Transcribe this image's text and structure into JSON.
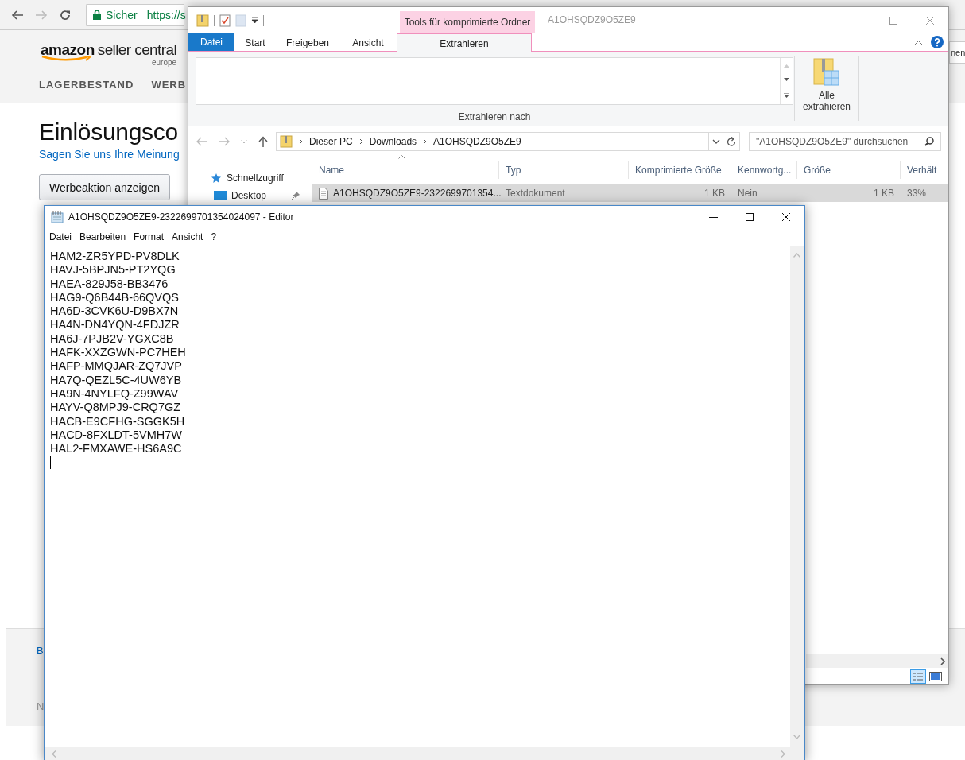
{
  "browser": {
    "security": "Sicher",
    "url": "https://s",
    "logo_brand": "amazon",
    "logo_product": "seller central",
    "logo_region": "europe",
    "nav": [
      "LAGERBESTAND",
      "WERB"
    ],
    "right_fragment": "nen",
    "heading": "Einlösungsco",
    "feedback_link": "Sagen Sie uns Ihre Meinung",
    "show_button": "Werbeaktion anzeigen",
    "footer": [
      "B",
      "N"
    ]
  },
  "explorer": {
    "contextual_group": "Tools für komprimierte Ordner",
    "title": "A1OHSQDZ9O5ZE9",
    "file_tab": "Datei",
    "tabs": [
      {
        "label": "Start",
        "selected": false
      },
      {
        "label": "Freigeben",
        "selected": false
      },
      {
        "label": "Ansicht",
        "selected": false
      },
      {
        "label": "Extrahieren",
        "selected": true
      }
    ],
    "ribbon_group": "Extrahieren nach",
    "extract_all": "Alle extrahieren",
    "breadcrumb": [
      "Dieser PC",
      "Downloads",
      "A1OHSQDZ9O5ZE9"
    ],
    "search": {
      "placeholder": "\"A1OHSQDZ9O5ZE9\" durchsuchen"
    },
    "nav": [
      {
        "label": "Schnellzugriff",
        "kind": "quick-access"
      },
      {
        "label": "Desktop",
        "kind": "desktop"
      }
    ],
    "columns": [
      "Name",
      "Typ",
      "Komprimierte Größe",
      "Kennwortg...",
      "Größe",
      "Verhält"
    ],
    "files": [
      {
        "cells": [
          "A1OHSQDZ9O5ZE9-2322699701354...",
          "Textdokument",
          "1 KB",
          "Nein",
          "1 KB",
          "33%"
        ],
        "selected": true
      }
    ]
  },
  "notepad": {
    "title": "A1OHSQDZ9O5ZE9-2322699701354024097 - Editor",
    "menu": [
      "Datei",
      "Bearbeiten",
      "Format",
      "Ansicht",
      "?"
    ],
    "lines": [
      "HAM2-ZR5YPD-PV8DLK",
      "HAVJ-5BPJN5-PT2YQG",
      "HAEA-829J58-BB3476",
      "HAG9-Q6B44B-66QVQS",
      "HA6D-3CVK6U-D9BX7N",
      "HA4N-DN4YQN-4FDJZR",
      "HA6J-7PJB2V-YGXC8B",
      "HAFK-XXZGWN-PC7HEH",
      "HAFP-MMQJAR-ZQ7JVP",
      "HA7Q-QEZL5C-4UW6YB",
      "HA9N-4NYLFQ-Z99WAV",
      "HAYV-Q8MPJ9-CRQ7GZ",
      "HACB-E9CFHG-SGGK5H",
      "HACD-8FXLDT-5VMH7W",
      "HAL2-FMXAWE-HS6A9C"
    ]
  }
}
